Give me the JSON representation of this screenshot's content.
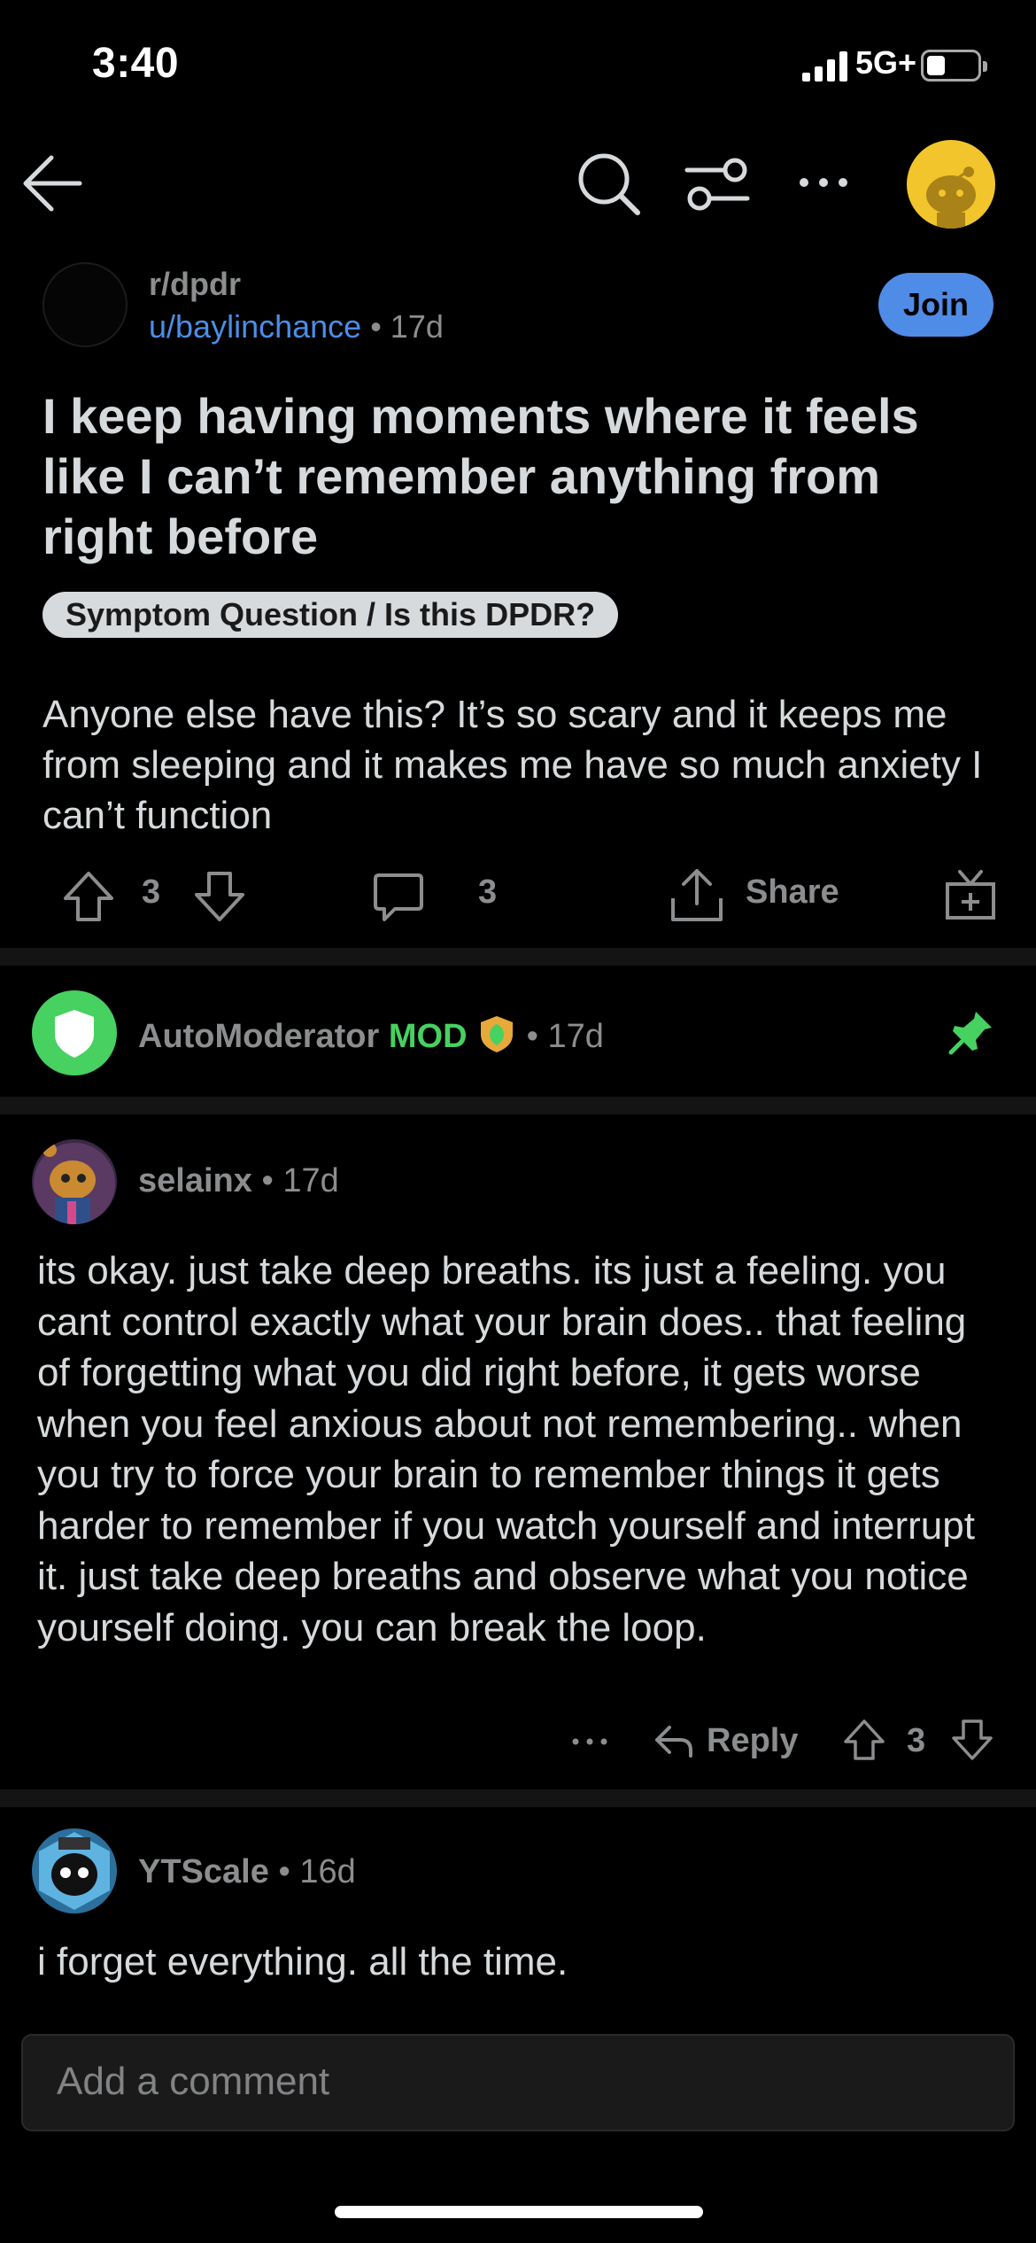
{
  "status_bar": {
    "time": "3:40",
    "network": "5G+"
  },
  "nav": {
    "icons": [
      "back-arrow-icon",
      "search-icon",
      "filter-icon",
      "more-icon",
      "profile-avatar"
    ]
  },
  "post": {
    "subreddit": "r/dpdr",
    "author": "u/baylinchance",
    "age": "17d",
    "join_label": "Join",
    "title": "I keep having moments where it feels like I can’t remember anything from right before",
    "flair": "Symptom Question / Is this DPDR?",
    "body": "Anyone else have this? It’s so scary and it keeps me from sleeping and it makes me have so much anxiety I can’t function",
    "votes": "3",
    "comments": "3",
    "share_label": "Share"
  },
  "automod": {
    "name": "AutoModerator",
    "badge": "MOD",
    "age": "17d",
    "accent": "#46d160"
  },
  "comments": [
    {
      "user": "selainx",
      "age": "17d",
      "body": "its okay. just take deep breaths. its just a feeling. you cant control exactly what your brain does.. that feeling of forgetting what you did right before, it gets worse when you feel anxious about not remembering.. when you try to force your brain to remember things it gets harder to remember if you watch yourself and interrupt it. just take deep breaths and observe what you notice yourself doing. you can break the loop.",
      "reply_label": "Reply",
      "votes": "3"
    },
    {
      "user": "YTScale",
      "age": "16d",
      "body": "i forget everything. all the time."
    }
  ],
  "composer": {
    "placeholder": "Add a comment"
  },
  "colors": {
    "background": "#000000",
    "link": "#4a8fe7",
    "join": "#4f8ce8",
    "text": "#d7dadc",
    "muted": "#8b8d8f"
  }
}
